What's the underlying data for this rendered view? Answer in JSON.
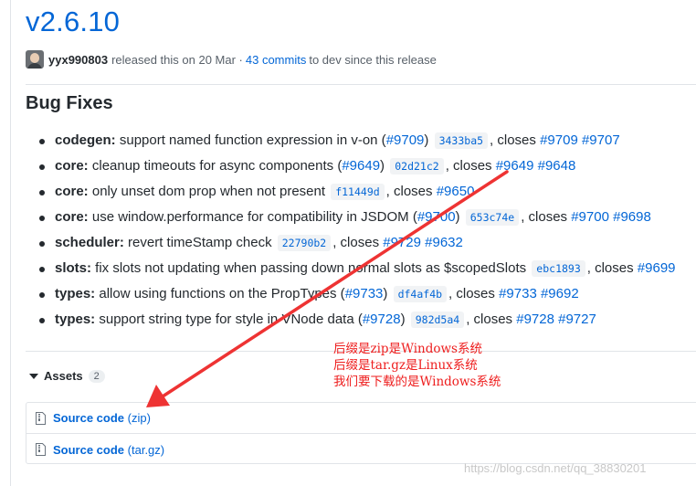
{
  "release": {
    "version": "v2.6.10",
    "author": "yyx990803",
    "released_text": "released this on 20 Mar ·",
    "commits_text": "43 commits",
    "branch_text": "to dev since this release"
  },
  "bug_fixes": {
    "heading": "Bug Fixes",
    "items": [
      {
        "scope": "codegen:",
        "desc": " support named function expression in v-on (",
        "pr": "#9709",
        "after_pr": ")",
        "sha": "3433ba5",
        "closes_text": ", closes ",
        "issues": [
          "#9709",
          "#9707"
        ]
      },
      {
        "scope": "core:",
        "desc": " cleanup timeouts for async components (",
        "pr": "#9649",
        "after_pr": ")",
        "sha": "02d21c2",
        "closes_text": ", closes ",
        "issues": [
          "#9649",
          "#9648"
        ]
      },
      {
        "scope": "core:",
        "desc": " only unset dom prop when not present",
        "pr": "",
        "after_pr": "",
        "sha": "f11449d",
        "closes_text": ", closes ",
        "issues": [
          "#9650"
        ]
      },
      {
        "scope": "core:",
        "desc": " use window.performance for compatibility in JSDOM (",
        "pr": "#9700",
        "after_pr": ")",
        "sha": "653c74e",
        "closes_text": ", closes ",
        "issues": [
          "#9700",
          "#9698"
        ]
      },
      {
        "scope": "scheduler:",
        "desc": " revert timeStamp check",
        "pr": "",
        "after_pr": "",
        "sha": "22790b2",
        "closes_text": ", closes ",
        "issues": [
          "#9729",
          "#9632"
        ]
      },
      {
        "scope": "slots:",
        "desc": " fix slots not updating when passing down normal slots as $scopedSlots",
        "pr": "",
        "after_pr": "",
        "sha": "ebc1893",
        "closes_text": ", closes ",
        "issues": [
          "#9699"
        ]
      },
      {
        "scope": "types:",
        "desc": " allow using functions on the PropTypes (",
        "pr": "#9733",
        "after_pr": ")",
        "sha": "df4af4b",
        "closes_text": ", closes ",
        "issues": [
          "#9733",
          "#9692"
        ]
      },
      {
        "scope": "types:",
        "desc": " support string type for style in VNode data (",
        "pr": "#9728",
        "after_pr": ")",
        "sha": "982d5a4",
        "closes_text": ", closes ",
        "issues": [
          "#9728",
          "#9727"
        ]
      }
    ]
  },
  "assets": {
    "label": "Assets",
    "count": "2",
    "files": [
      {
        "name": "Source code",
        "ext": "(zip)"
      },
      {
        "name": "Source code",
        "ext": "(tar.gz)"
      }
    ]
  },
  "annotation": {
    "lines": [
      "后缀是zip是Windows系统",
      "后缀是tar.gz是Linux系统",
      "我们要下载的是Windows系统"
    ],
    "color": "#ee1d1d"
  },
  "watermark": "https://blog.csdn.net/qq_38830201"
}
